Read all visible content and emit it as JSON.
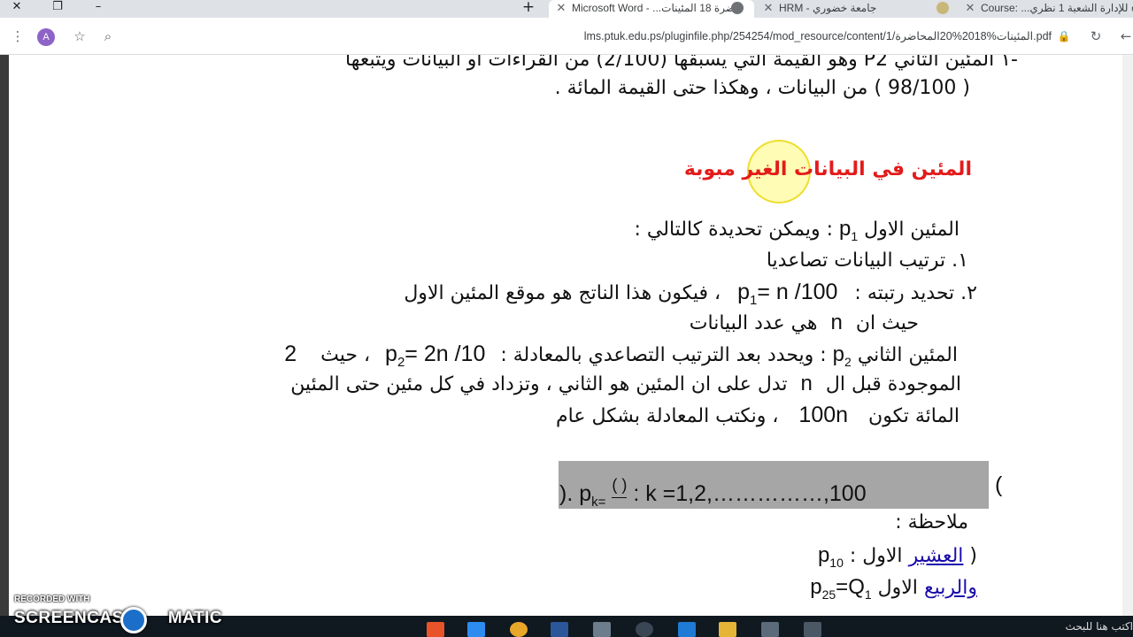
{
  "browser": {
    "tabs": [
      {
        "title": "Microsoft Word - ...ضرة 18 المئينات",
        "active": true
      },
      {
        "title": "HRM - جامعة خضوري",
        "active": false
      },
      {
        "title": "Course: ...ضاء للإدارة الشعبة 1 نظري",
        "active": false
      }
    ],
    "new_tab_label": "+",
    "address_url": "lms.ptuk.edu.ps/pluginfile.php/254254/mod_resource/content/1/المئينات%2018%20المحاضرة.pdf",
    "avatar_letter": "A"
  },
  "document": {
    "line_top_1": "-١  المئين الثاني  P2  وهو القيمة التي يسبقها (2/100) من القراءات او البيانات ويتبعها",
    "line_top_2": "( 98/100 ) من البيانات  ، وهكذا حتى القيمة المائة .",
    "heading": "المئين في البيانات الغير مبوبة",
    "p1_label": "المئين  الاول",
    "p1_sym": "p",
    "p1_sub": "1",
    "p1_rest": ": ويمكن تحديدة كالتالي :",
    "step1": "١.  ترتيب البيانات تصاعديا",
    "step2_pre": "٢.  تحديد رتبته :",
    "step2_formula": "p",
    "step2_formula_sub": "1",
    "step2_formula_rest": "=  n /100",
    "step2_post": "، فيكون هذا الناتج هو موقع المئين الاول",
    "where_pre": "حيث ان",
    "where_n": "n",
    "where_post": "هي عدد البيانات",
    "p2_label": "المئين الثاني",
    "p2_sym": "p",
    "p2_sub": "2",
    "p2_rest": ": ويحدد بعد الترتيب التصاعدي بالمعادلة :",
    "p2_formula": "p",
    "p2_formula_sub": "2",
    "p2_formula_rest": "=  2n /10",
    "p2_haith": "، حيث",
    "p2_two": "2",
    "line_b1_pre": "الموجودة قبل ال",
    "line_b1_n": "n",
    "line_b1_post": "تدل على ان المئين هو الثاني ،  وتزداد في كل مئين  حتى المئين",
    "line_b2_pre": "المائة تكون",
    "line_b2_val": "100n",
    "line_b2_post": "، ونكتب المعادلة بشكل عام",
    "formula_open": "(",
    "formula_p": "p",
    "formula_sub": "k=",
    "formula_paren": "(      )",
    "formula_k": ":  k =1,2,……………,100",
    "formula_close": ").",
    "note": "ملاحظة :",
    "tenth_link": "العشير",
    "tenth_rest": "الاول  :",
    "tenth_p": "p",
    "tenth_sub": "10",
    "tenth_open": "(",
    "quart_link": "والربيع",
    "quart_rest": "الاول",
    "quart_p": "p",
    "quart_sub": "25",
    "quart_eq": "=Q",
    "quart_eq_sub": "1"
  },
  "taskbar": {
    "search_placeholder": "اكتب هنا للبحث"
  },
  "watermark": {
    "small": "RECORDED WITH",
    "big": "SCREENCAST",
    "big_tail": "MATIC"
  },
  "colors": {
    "heading": "#e31b1b",
    "link": "#1a0dab",
    "formula_bg": "#a6a6a6",
    "avatar": "#8e63c7"
  }
}
